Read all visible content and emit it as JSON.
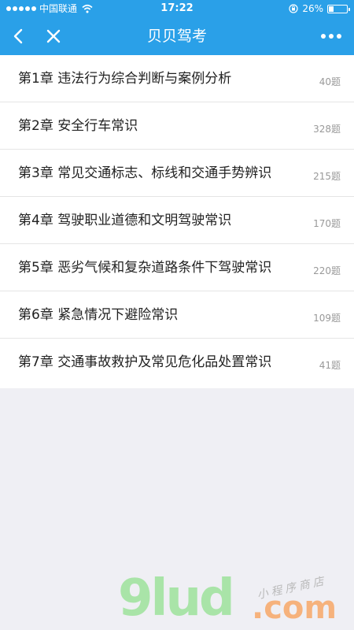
{
  "status_bar": {
    "carrier": "中国联通",
    "time": "17:22",
    "battery": "26%",
    "battery_level": 0.26,
    "icons": [
      "signal-dots-icon",
      "wifi-icon",
      "orientation-lock-icon",
      "battery-icon"
    ]
  },
  "nav": {
    "title": "贝贝驾考",
    "back_icon": "chevron-left-icon",
    "close_icon": "close-icon",
    "more_icon": "more-dots-icon"
  },
  "chapters": [
    {
      "title": "第1章  违法行为综合判断与案例分析",
      "count": "40题"
    },
    {
      "title": "第2章  安全行车常识",
      "count": "328题"
    },
    {
      "title": "第3章  常见交通标志、标线和交通手势辨识",
      "count": "215题"
    },
    {
      "title": "第4章  驾驶职业道德和文明驾驶常识",
      "count": "170题"
    },
    {
      "title": "第5章  恶劣气候和复杂道路条件下驾驶常识",
      "count": "220题"
    },
    {
      "title": "第6章  紧急情况下避险常识",
      "count": "109题"
    },
    {
      "title": "第7章  交通事故救护及常见危化品处置常识",
      "count": "41题"
    }
  ],
  "watermark": {
    "logo": "9lud",
    "suffix": ".com",
    "tagline": "小程序商店"
  },
  "colors": {
    "header_bg": "#2aa0e8",
    "page_bg": "#efeff4",
    "list_bg": "#ffffff",
    "title_text": "#222222",
    "count_text": "#999999"
  }
}
